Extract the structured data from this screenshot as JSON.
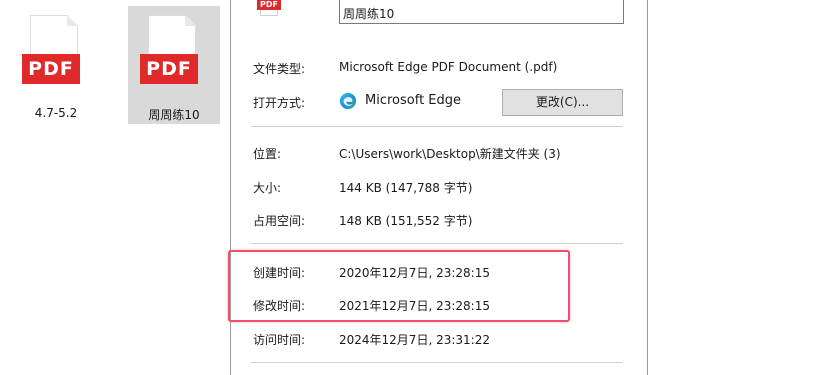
{
  "desktop": {
    "files": [
      {
        "label": "4.7-5.2",
        "badge": "PDF",
        "selected": false
      },
      {
        "label": "周周练10",
        "badge": "PDF",
        "selected": true
      }
    ]
  },
  "dialog": {
    "small_icon_text": "PDF",
    "file_name": "周周练10",
    "file_type_label": "文件类型:",
    "file_type_value": "Microsoft Edge PDF Document (.pdf)",
    "opens_with_label": "打开方式:",
    "opens_with_value": "Microsoft Edge",
    "change_button": "更改(C)...",
    "location_label": "位置:",
    "location_value": "C:\\Users\\work\\Desktop\\新建文件夹 (3)",
    "size_label": "大小:",
    "size_value": "144 KB (147,788 字节)",
    "size_on_disk_label": "占用空间:",
    "size_on_disk_value": "148 KB (151,552 字节)",
    "created_label": "创建时间:",
    "created_value": "2020年12月7日, 23:28:15",
    "modified_label": "修改时间:",
    "modified_value": "2021年12月7日, 23:28:15",
    "accessed_label": "访问时间:",
    "accessed_value": "2024年12月7日, 23:31:22"
  },
  "colors": {
    "pdf_red": "#e02a2a",
    "highlight": "#f0506a",
    "selection": "#d9d9d9",
    "button_bg": "#e1e1e1"
  }
}
